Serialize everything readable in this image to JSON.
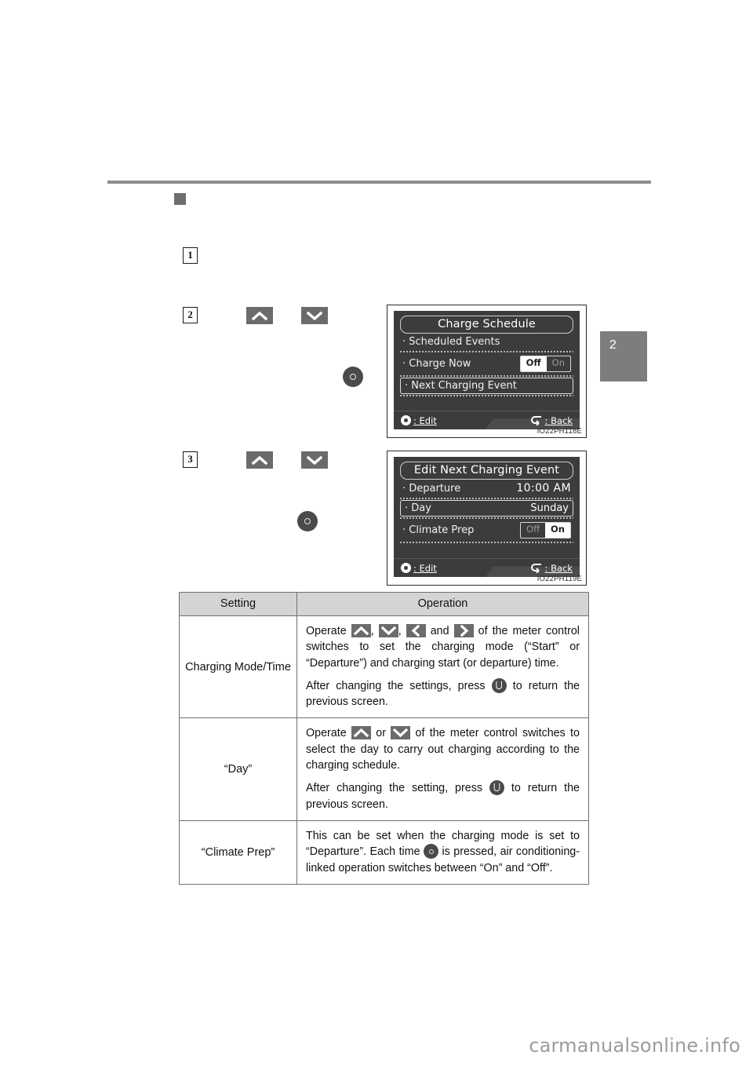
{
  "page": {
    "side_tab_number": "2",
    "watermark": "carmanualsonline.info"
  },
  "steps": {
    "step1": "1",
    "step2": "2",
    "step3": "3"
  },
  "meter_displays": [
    {
      "id_label": "IO22PH118E",
      "title": "Charge Schedule",
      "rows": [
        {
          "label": "Scheduled Events",
          "value": "",
          "type": "plain",
          "boxed": false
        },
        {
          "label": "Charge Now",
          "type": "toggle",
          "boxed": false,
          "toggle": {
            "off": "Off",
            "on": "On",
            "selected": "Off"
          }
        },
        {
          "label": "Next Charging Event",
          "value": "",
          "type": "plain",
          "boxed": true
        }
      ],
      "footer": {
        "edit": ": Edit",
        "back": ": Back"
      }
    },
    {
      "id_label": "IO22PH119E",
      "title": "Edit Next Charging Event",
      "rows": [
        {
          "label": "Departure",
          "value": "10:00 AM",
          "type": "value",
          "boxed": false
        },
        {
          "label": "Day",
          "value": "Sunday",
          "type": "value",
          "boxed": true
        },
        {
          "label": "Climate Prep",
          "type": "toggle",
          "boxed": false,
          "toggle": {
            "off": "Off",
            "on": "On",
            "selected": "On"
          }
        }
      ],
      "footer": {
        "edit": ": Edit",
        "back": ": Back"
      }
    }
  ],
  "settings_table": {
    "headers": {
      "setting": "Setting",
      "operation": "Operation"
    },
    "rows": [
      {
        "setting": "Charging Mode/Time",
        "paragraph1_a": "Operate ",
        "paragraph1_b": ", ",
        "paragraph1_c": ", ",
        "paragraph1_d": " and ",
        "paragraph1_e": " of the meter control switches to set the charging mode (“Start” or “Departure”) and charging start (or departure) time.",
        "paragraph2_a": "After changing the settings, press ",
        "paragraph2_b": " to return the previous screen."
      },
      {
        "setting": "“Day”",
        "paragraph1_a": "Operate ",
        "paragraph1_b": " or ",
        "paragraph1_c": " of the meter control switches to select the day to carry out charging according to the charging schedule.",
        "paragraph2_a": "After changing the setting, press ",
        "paragraph2_b": " to return the previous screen."
      },
      {
        "setting": "“Climate Prep”",
        "paragraph1_a": "This can be set when the charging mode is set to “Departure”. Each time ",
        "paragraph1_b": " is pressed, air conditioning-linked operation switches between “On” and “Off”."
      }
    ]
  },
  "icons": {
    "chevron_up": "chevron-up-icon",
    "chevron_down": "chevron-down-icon",
    "chevron_left": "chevron-left-icon",
    "chevron_right": "chevron-right-icon",
    "enter_button": "enter-button-icon",
    "back_button": "back-button-icon"
  },
  "colors": {
    "screen_bg": "#3c3c3c",
    "table_header": "#d4d4d4",
    "icon_gray": "#6b6b6b",
    "rule_gray": "#8d8d8d"
  }
}
